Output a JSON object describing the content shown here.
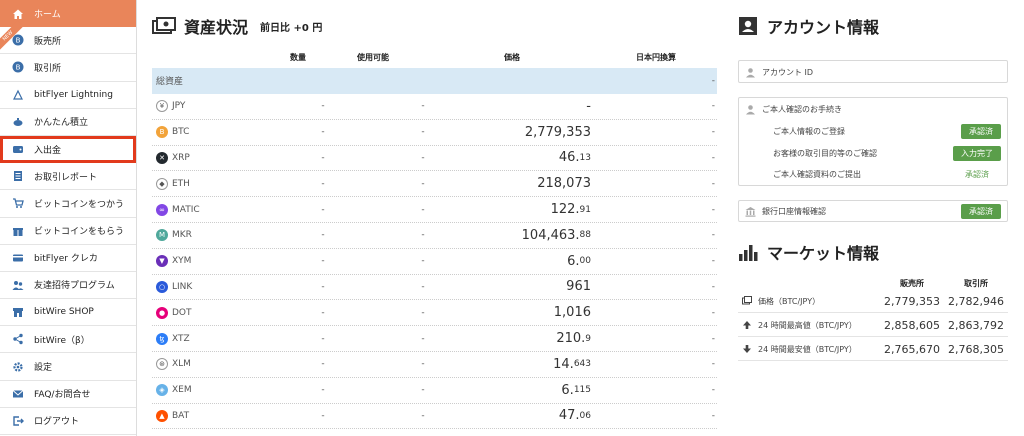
{
  "sidebar": {
    "items": [
      {
        "label": "ホーム",
        "icon": "home-icon"
      },
      {
        "label": "販売所",
        "icon": "bitcoin-coin-icon"
      },
      {
        "label": "取引所",
        "icon": "bitcoin-coin-icon"
      },
      {
        "label": "bitFlyer Lightning",
        "icon": "lightning-icon"
      },
      {
        "label": "かんたん積立",
        "icon": "piggy-bank-icon"
      },
      {
        "label": "入出金",
        "icon": "wallet-icon"
      },
      {
        "label": "お取引レポート",
        "icon": "document-icon"
      },
      {
        "label": "ビットコインをつかう",
        "icon": "cart-icon"
      },
      {
        "label": "ビットコインをもらう",
        "icon": "gift-icon"
      },
      {
        "label": "bitFlyer クレカ",
        "icon": "credit-card-icon"
      },
      {
        "label": "友達招待プログラム",
        "icon": "users-icon"
      },
      {
        "label": "bitWire SHOP",
        "icon": "shop-icon"
      },
      {
        "label": "bitWire（β）",
        "icon": "share-icon"
      },
      {
        "label": "設定",
        "icon": "gear-icon"
      },
      {
        "label": "FAQ/お問合せ",
        "icon": "mail-icon"
      },
      {
        "label": "ログアウト",
        "icon": "logout-icon"
      }
    ],
    "new_badge": "NEW"
  },
  "assets": {
    "title": "資産状況",
    "subtitle": "前日比 +0 円",
    "columns": [
      "数量",
      "使用可能",
      "価格",
      "日本円換算"
    ],
    "total_label": "総資産",
    "total_value": "-",
    "rows": [
      {
        "name": "JPY",
        "qty": "-",
        "avail": "-",
        "price_main": "-",
        "price_dec": "",
        "jpy": "-",
        "color": "#ffffff",
        "glyph": "¥"
      },
      {
        "name": "BTC",
        "qty": "-",
        "avail": "-",
        "price_main": "2,779,353",
        "price_dec": "",
        "jpy": "-",
        "color": "#f2a33a",
        "glyph": "B"
      },
      {
        "name": "XRP",
        "qty": "-",
        "avail": "-",
        "price_main": "46.",
        "price_dec": "13",
        "jpy": "-",
        "color": "#23292f",
        "glyph": "✕"
      },
      {
        "name": "ETH",
        "qty": "-",
        "avail": "-",
        "price_main": "218,073",
        "price_dec": "",
        "jpy": "-",
        "color": "#ffffff",
        "glyph": "◆"
      },
      {
        "name": "MATIC",
        "qty": "-",
        "avail": "-",
        "price_main": "122.",
        "price_dec": "91",
        "jpy": "-",
        "color": "#8247e5",
        "glyph": "∞"
      },
      {
        "name": "MKR",
        "qty": "-",
        "avail": "-",
        "price_main": "104,463.",
        "price_dec": "88",
        "jpy": "-",
        "color": "#4fa89b",
        "glyph": "M"
      },
      {
        "name": "XYM",
        "qty": "-",
        "avail": "-",
        "price_main": "6.",
        "price_dec": "00",
        "jpy": "-",
        "color": "#6a2fb8",
        "glyph": "▼"
      },
      {
        "name": "LINK",
        "qty": "-",
        "avail": "-",
        "price_main": "961",
        "price_dec": "",
        "jpy": "-",
        "color": "#2a5ada",
        "glyph": "○"
      },
      {
        "name": "DOT",
        "qty": "-",
        "avail": "-",
        "price_main": "1,016",
        "price_dec": "",
        "jpy": "-",
        "color": "#e6007a",
        "glyph": "●"
      },
      {
        "name": "XTZ",
        "qty": "-",
        "avail": "-",
        "price_main": "210.",
        "price_dec": "9",
        "jpy": "-",
        "color": "#2c7df7",
        "glyph": "ꜩ"
      },
      {
        "name": "XLM",
        "qty": "-",
        "avail": "-",
        "price_main": "14.",
        "price_dec": "643",
        "jpy": "-",
        "color": "#ffffff",
        "glyph": "⊛"
      },
      {
        "name": "XEM",
        "qty": "-",
        "avail": "-",
        "price_main": "6.",
        "price_dec": "115",
        "jpy": "-",
        "color": "#67b2e8",
        "glyph": "◈"
      },
      {
        "name": "BAT",
        "qty": "-",
        "avail": "-",
        "price_main": "47.",
        "price_dec": "06",
        "jpy": "-",
        "color": "#ff5000",
        "glyph": "▲"
      }
    ]
  },
  "account": {
    "title": "アカウント情報",
    "account_id_label": "アカウント ID",
    "verify_title": "ご本人確認のお手続き",
    "verify_items": [
      {
        "label": "ご本人情報のご登録",
        "status": "承認済",
        "style": "badge"
      },
      {
        "label": "お客様の取引目的等のご確認",
        "status": "入力完了",
        "style": "badge"
      },
      {
        "label": "ご本人確認資料のご提出",
        "status": "承認済",
        "style": "text"
      }
    ],
    "bank_label": "銀行口座情報確認",
    "bank_status": "承認済"
  },
  "market": {
    "title": "マーケット情報",
    "col_sell": "販売所",
    "col_exchange": "取引所",
    "rows": [
      {
        "label": "価格（BTC/JPY）",
        "sell": "2,779,353",
        "exchange": "2,782,946",
        "icon": "price-tag-icon"
      },
      {
        "label": "24 時間最高値（BTC/JPY）",
        "sell": "2,858,605",
        "exchange": "2,863,792",
        "icon": "arrow-up-icon"
      },
      {
        "label": "24 時間最安値（BTC/JPY）",
        "sell": "2,765,670",
        "exchange": "2,768,305",
        "icon": "arrow-down-icon"
      }
    ]
  },
  "colors": {
    "accent": "#e9855a",
    "highlight": "#e23a1c",
    "success": "#5a9e4a",
    "total_row": "#d8e9f5"
  }
}
